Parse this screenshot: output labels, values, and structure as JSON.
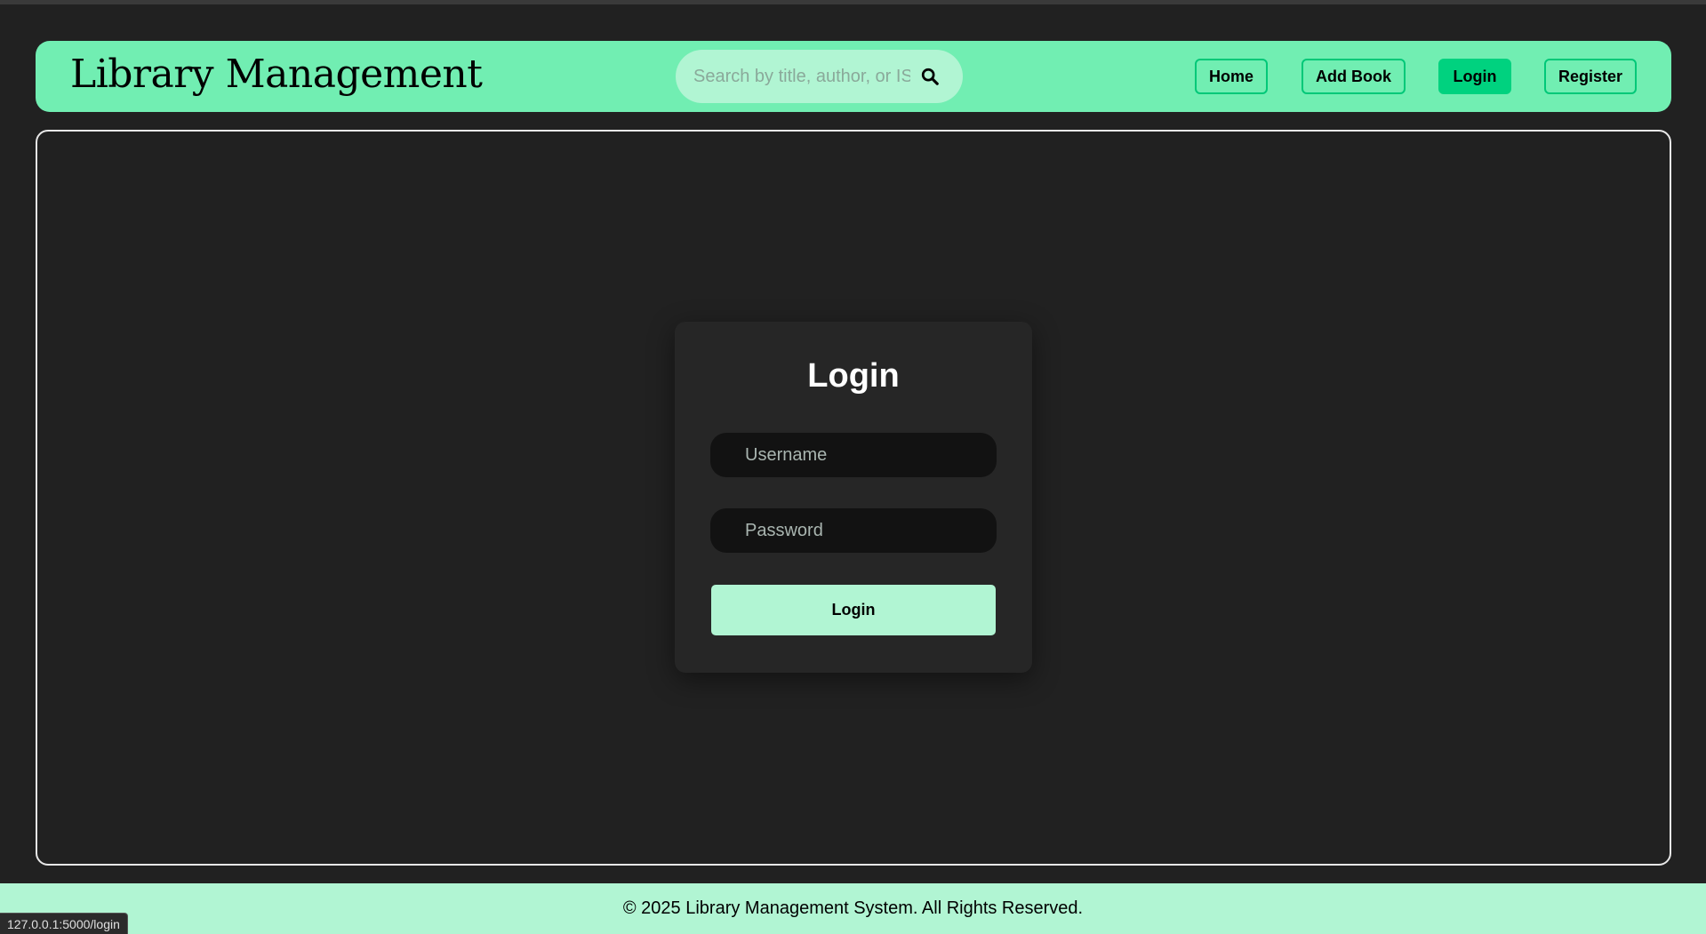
{
  "header": {
    "brand": "Library Management",
    "search": {
      "placeholder": "Search by title, author, or ISBN",
      "value": ""
    },
    "nav": [
      {
        "label": "Home",
        "active": false
      },
      {
        "label": "Add Book",
        "active": false
      },
      {
        "label": "Login",
        "active": true
      },
      {
        "label": "Register",
        "active": false
      }
    ]
  },
  "login": {
    "title": "Login",
    "username_placeholder": "Username",
    "password_placeholder": "Password",
    "submit_label": "Login"
  },
  "footer": {
    "text": "© 2025 Library Management System. All Rights Reserved."
  },
  "status_bar": {
    "url": "127.0.0.1:5000/login"
  },
  "colors": {
    "background": "#212121",
    "navbar": "#71eeb2",
    "accent": "#00d27f",
    "light_accent": "#b1f5d3",
    "card": "#262626"
  },
  "icons": {
    "search": "search-icon"
  }
}
